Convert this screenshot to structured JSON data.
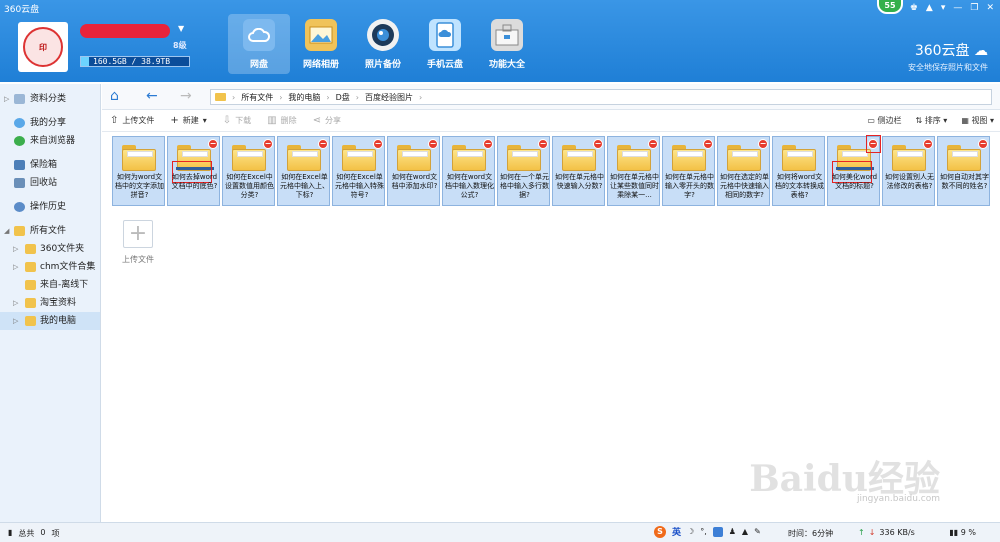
{
  "header": {
    "app_title": "360云盘",
    "level": "8级",
    "storage": "160.5GB / 38.9TB",
    "notification_count": "55",
    "brand_name": "360云盘",
    "brand_slogan": "安全地保存照片和文件",
    "nav": [
      {
        "label": "网盘",
        "icon": "cloud-disk-icon",
        "active": true
      },
      {
        "label": "网络相册",
        "icon": "photo-album-icon",
        "active": false
      },
      {
        "label": "照片备份",
        "icon": "camera-icon",
        "active": false
      },
      {
        "label": "手机云盘",
        "icon": "phone-cloud-icon",
        "active": false
      },
      {
        "label": "功能大全",
        "icon": "toolbox-icon",
        "active": false
      }
    ]
  },
  "sidebar": {
    "items": [
      {
        "label": "资料分类",
        "icon": "category-icon"
      },
      {
        "label": "我的分享",
        "icon": "share-icon"
      },
      {
        "label": "来自浏览器",
        "icon": "browser-icon"
      },
      {
        "label": "保险箱",
        "icon": "safe-icon"
      },
      {
        "label": "回收站",
        "icon": "recycle-bin-icon"
      },
      {
        "label": "操作历史",
        "icon": "history-icon"
      },
      {
        "label": "所有文件",
        "icon": "folder-icon"
      }
    ],
    "folders": [
      {
        "label": "360文件夹"
      },
      {
        "label": "chm文件合集"
      },
      {
        "label": "来自-离线下"
      },
      {
        "label": "淘宝资料"
      },
      {
        "label": "我的电脑"
      }
    ]
  },
  "breadcrumb": {
    "parts": [
      "所有文件",
      "我的电脑",
      "D盘",
      "百度经验图片"
    ]
  },
  "toolbar": {
    "upload": "上传文件",
    "new": "新建",
    "download": "下载",
    "delete": "删除",
    "share": "分享",
    "sidebar_toggle": "侧边栏",
    "sort": "排序",
    "view": "视图"
  },
  "files": [
    {
      "name": "如何为word文档中的文字添加拼音?"
    },
    {
      "name": "如何去掉word文档中的底色?"
    },
    {
      "name": "如何在Excel中设置数值用颜色分类?"
    },
    {
      "name": "如何在Excel单元格中输入上、下标?"
    },
    {
      "name": "如何在Excel单元格中输入特殊符号?"
    },
    {
      "name": "如何在word文档中添加水印?"
    },
    {
      "name": "如何在word文档中输入数理化公式?"
    },
    {
      "name": "如何在一个单元格中输入多行数据?"
    },
    {
      "name": "如何在单元格中快速输入分数?"
    },
    {
      "name": "如何在单元格中让某些数值同时乘除某一..."
    },
    {
      "name": "如何在单元格中输入零开头的数字?"
    },
    {
      "name": "如何在选定的单元格中快速输入相同的数字?"
    },
    {
      "name": "如何将word文档的文本转换成表格?"
    },
    {
      "name": "如何美化word文档的标题?"
    },
    {
      "name": "如何设置别人无法修改的表格?"
    },
    {
      "name": "如何自动对其字数不同的姓名?"
    }
  ],
  "upload_tile": "上传文件",
  "status": {
    "total_label": "总共",
    "total_value": "0",
    "total_unit": "项",
    "ime_lang": "英",
    "time_label": "时间：6分钟",
    "speed": "336 KB/s",
    "percent": "9 %"
  },
  "watermark": {
    "text": "Baidu经验",
    "url": "jingyan.baidu.com"
  }
}
